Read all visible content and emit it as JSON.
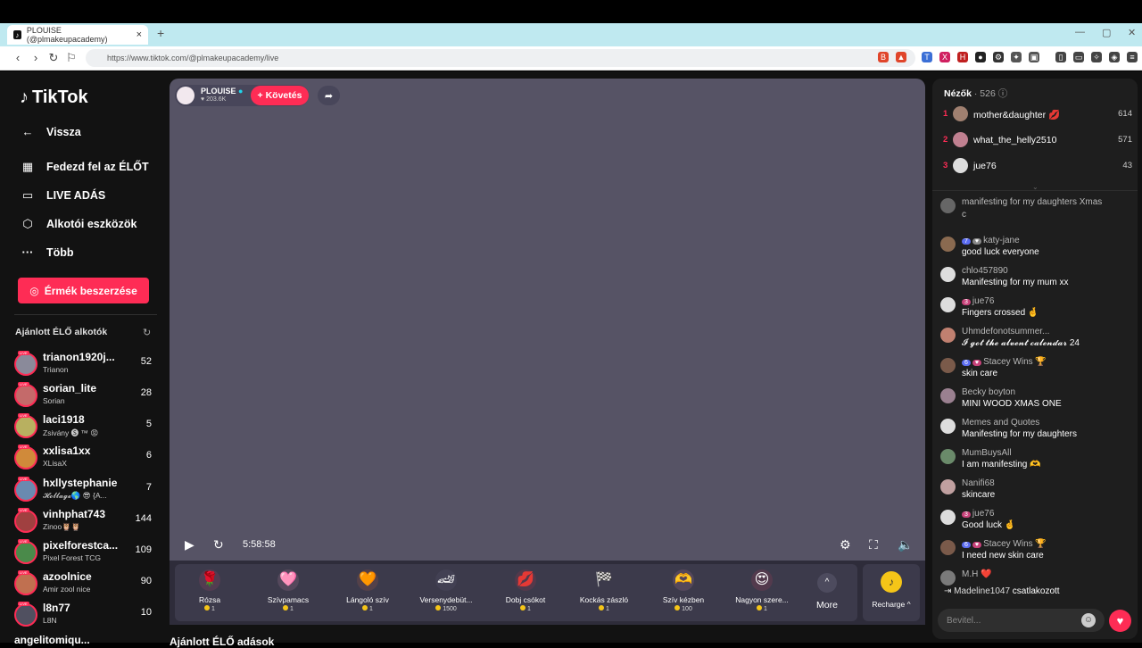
{
  "browser": {
    "tab_title": "PLOUISE (@plmakeupacademy)",
    "url": "https://www.tiktok.com/@plmakeupacademy/live"
  },
  "sidebar": {
    "logo": "TikTok",
    "back": "Vissza",
    "items": [
      {
        "label": "Fedezd fel az ÉLŐT",
        "icon": "calendar-icon"
      },
      {
        "label": "LIVE ADÁS",
        "icon": "video-icon"
      },
      {
        "label": "Alkotói eszközök",
        "icon": "tools-icon"
      },
      {
        "label": "Több",
        "icon": "more-icon"
      }
    ],
    "coins_button": "Érmék beszerzése",
    "recommended_title": "Ajánlott ÉLŐ alkotók",
    "creators": [
      {
        "name": "trianon1920j...",
        "sub": "Trianon",
        "count": "52",
        "color": "#8a8a9a"
      },
      {
        "name": "sorian_lite",
        "sub": "Sorian",
        "count": "28",
        "color": "#c46a6a"
      },
      {
        "name": "laci1918",
        "sub": "Zsivány 🅢 ™ 😡",
        "count": "5",
        "color": "#b8b060"
      },
      {
        "name": "xxlisa1xx",
        "sub": "XLisaX",
        "count": "6",
        "color": "#d08a3a"
      },
      {
        "name": "hxllystephanie",
        "sub": "𝓗𝓸𝓵𝓵𝓪𝓰𝓮🌎 😎 {A...",
        "count": "7",
        "color": "#6a8ab0"
      },
      {
        "name": "vinhphat743",
        "sub": "Zinoo🦉🦉",
        "count": "144",
        "color": "#a04040"
      },
      {
        "name": "pixelforestca...",
        "sub": "Pixel Forest TCG",
        "count": "109",
        "color": "#4a8a4a"
      },
      {
        "name": "azoolnice",
        "sub": "Amir zool nice",
        "count": "90",
        "color": "#c07050"
      },
      {
        "name": "l8n77",
        "sub": "L8N",
        "count": "10",
        "color": "#505060"
      }
    ],
    "more_partial": "angelitomiqu..."
  },
  "player": {
    "host_name": "PLOUISE",
    "host_likes": "203.6K",
    "follow_label": "+ Követés",
    "time": "5:58:58",
    "below_label": "Ajánlott ÉLŐ adások"
  },
  "gifts": [
    {
      "name": "Rózsa",
      "price": "1",
      "icon": "🌹"
    },
    {
      "name": "Szívpamacs",
      "price": "1",
      "icon": "🩷"
    },
    {
      "name": "Lángoló szív",
      "price": "1",
      "icon": "🧡"
    },
    {
      "name": "Versenydebüt...",
      "price": "1500",
      "icon": "🏎"
    },
    {
      "name": "Dobj csókot",
      "price": "1",
      "icon": "💋"
    },
    {
      "name": "Kockás zászló",
      "price": "1",
      "icon": "🏁"
    },
    {
      "name": "Szív kézben",
      "price": "100",
      "icon": "🫶"
    },
    {
      "name": "Nagyon szere...",
      "price": "1",
      "icon": "😍"
    }
  ],
  "gift_more": "More",
  "recharge": "Recharge",
  "viewers_panel": {
    "title": "Nézők",
    "count": "526",
    "top": [
      {
        "rank": "1",
        "name": "mother&daughter 💋",
        "score": "614",
        "color": "#a08070"
      },
      {
        "rank": "2",
        "name": "what_the_helly2510",
        "score": "571",
        "color": "#c08090"
      },
      {
        "rank": "3",
        "name": "jue76",
        "score": "43",
        "color": "#dddddd"
      }
    ]
  },
  "chat": [
    {
      "user": "",
      "text": "manifesting for my daughters Xmas",
      "badges": "",
      "color": "#666"
    },
    {
      "user": "",
      "text": "c",
      "badges": "",
      "color": ""
    },
    {
      "user": "katy-jane",
      "text": "good luck everyone",
      "badges": "7",
      "color": "#8a6a50"
    },
    {
      "user": "chlo457890",
      "text": "Manifesting for my mum xx",
      "badges": "",
      "color": "#dddddd"
    },
    {
      "user": "jue76",
      "text": "Fingers crossed 🤞",
      "badges": "3",
      "color": "#dddddd"
    },
    {
      "user": "Uhmdefonotsummer...",
      "text": "𝓘 𝓰𝓸𝓽 𝓽𝓱𝓮 𝓪𝓵𝓿𝓮𝓷𝓽 𝓬𝓪𝓵𝓮𝓷𝓭𝓪𝓻 24",
      "badges": "",
      "color": "#c08070"
    },
    {
      "user": "Stacey Wins 🏆",
      "text": "skin care",
      "badges": "6",
      "color": "#7a5a4a"
    },
    {
      "user": "Becky boyton",
      "text": "MINI WOOD XMAS ONE",
      "badges": "",
      "color": "#9a8090"
    },
    {
      "user": "Memes and Quotes",
      "text": "Manifesting for my daughters",
      "badges": "",
      "color": "#dddddd"
    },
    {
      "user": "MumBuysAll",
      "text": "I am manifesting 🫶",
      "badges": "",
      "color": "#6a8a6a"
    },
    {
      "user": "Nanifi68",
      "text": "skincare",
      "badges": "",
      "color": "#c0a0a0"
    },
    {
      "user": "jue76",
      "text": "Good luck 🤞",
      "badges": "3",
      "color": "#dddddd"
    },
    {
      "user": "Stacey Wins 🏆",
      "text": "I need new skin care",
      "badges": "6",
      "color": "#7a5a4a"
    },
    {
      "user": "M.H ❤️",
      "text": "",
      "badges": "",
      "color": "#7a7a7a"
    }
  ],
  "joined": {
    "user": "Madeline1047",
    "text": "csatlakozott"
  },
  "input_placeholder": "Bevitel..."
}
